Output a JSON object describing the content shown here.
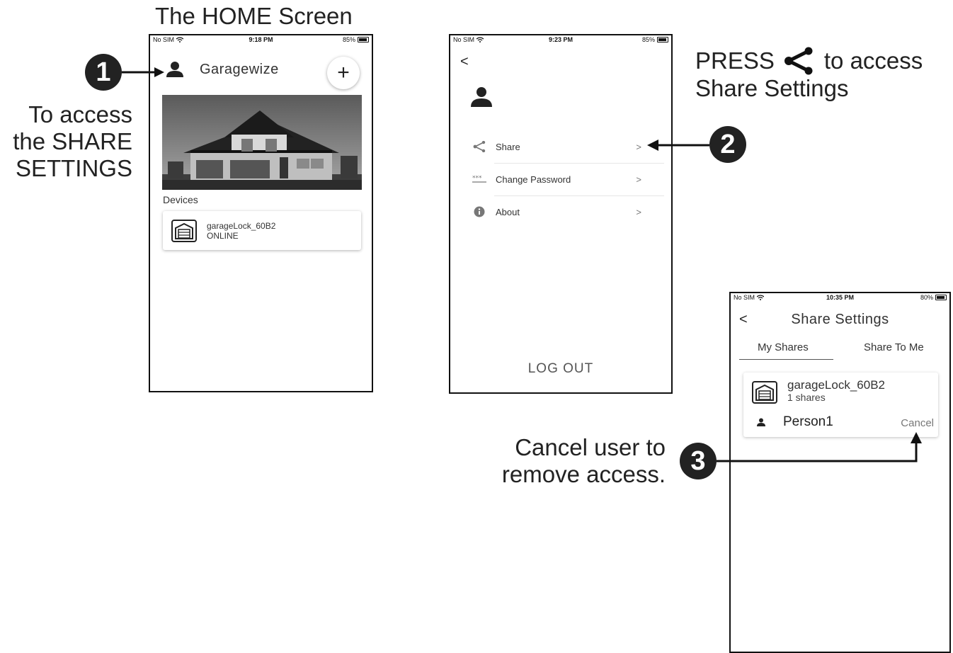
{
  "annotations": {
    "home_heading": "The HOME Screen",
    "step1_number": "1",
    "step1_text": "To access the SHARE SETTINGS",
    "step2_number": "2",
    "step2_press": "PRESS",
    "step2_suffix": "to access",
    "step2_line2": "Share Settings",
    "step3_number": "3",
    "step3_text": "Cancel user to remove access."
  },
  "home_screen": {
    "status": {
      "carrier": "No SIM",
      "time": "9:18 PM",
      "battery": "85%"
    },
    "app_title": "Garagewize",
    "add_label": "+",
    "devices_label": "Devices",
    "device": {
      "name": "garageLock_60B2",
      "status": "ONLINE"
    }
  },
  "profile_screen": {
    "status": {
      "carrier": "No SIM",
      "time": "9:23 PM",
      "battery": "85%"
    },
    "back_label": "<",
    "menu": [
      {
        "label": "Share",
        "icon": "share-icon",
        "chevron": ">"
      },
      {
        "label": "Change Password",
        "icon": "password-icon",
        "chevron": ">"
      },
      {
        "label": "About",
        "icon": "info-icon",
        "chevron": ">"
      }
    ],
    "logout_label": "LOG OUT"
  },
  "share_screen": {
    "status": {
      "carrier": "No SIM",
      "time": "10:35 PM",
      "battery": "80%"
    },
    "back_label": "<",
    "title": "Share Settings",
    "tabs": [
      "My Shares",
      "Share To Me"
    ],
    "device_name": "garageLock_60B2",
    "share_count": "1 shares",
    "person": "Person1",
    "cancel_label": "Cancel"
  },
  "colors": {
    "ink": "#111111",
    "circle_fill": "#222222",
    "card_shadow": "#cccccc"
  }
}
